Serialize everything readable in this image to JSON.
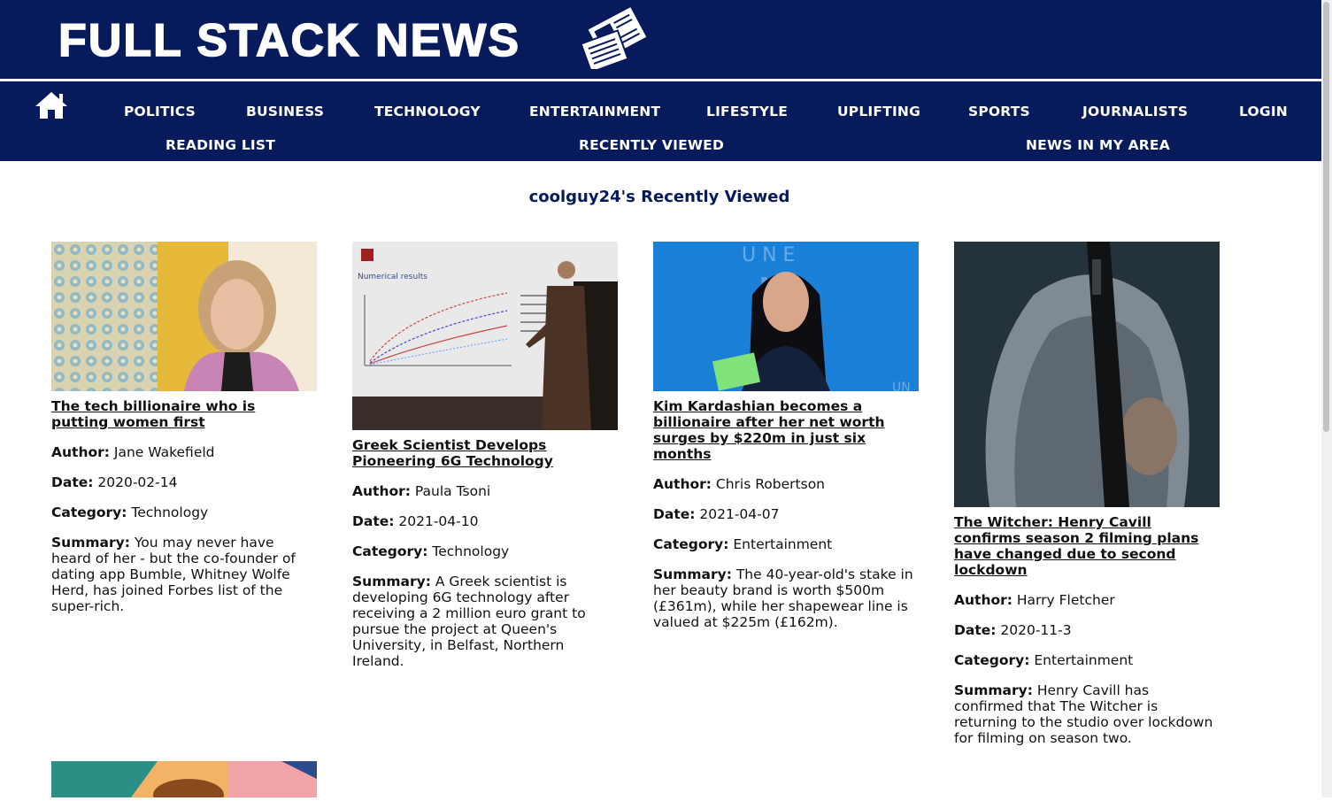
{
  "site": {
    "logo_text": "FULL STACK NEWS"
  },
  "nav": {
    "row1": [
      "POLITICS",
      "BUSINESS",
      "TECHNOLOGY",
      "ENTERTAINMENT",
      "LIFESTYLE",
      "UPLIFTING",
      "SPORTS",
      "JOURNALISTS",
      "LOGIN"
    ],
    "row2": [
      "READING LIST",
      "RECENTLY VIEWED",
      "NEWS IN MY AREA"
    ]
  },
  "page": {
    "heading": "coolguy24's Recently Viewed"
  },
  "labels": {
    "author": "Author:",
    "date": "Date:",
    "category": "Category:",
    "summary": "Summary:"
  },
  "articles": [
    {
      "title": "The tech billionaire who is putting women first",
      "author": "Jane Wakefield",
      "date": "2020-02-14",
      "category": "Technology",
      "summary": "You may never have heard of her - but the co-founder of dating app Bumble, Whitney Wolfe Herd, has joined Forbes list of the super-rich."
    },
    {
      "title": "Greek Scientist Develops Pioneering 6G Technology",
      "author": "Paula Tsoni",
      "date": "2021-04-10",
      "category": "Technology",
      "summary": "A Greek scientist is developing 6G technology after receiving a 2 million euro grant to pursue the project at Queen's University, in Belfast, Northern Ireland."
    },
    {
      "title": "Kim Kardashian becomes a billionaire after her net worth surges by $220m in just six months",
      "author": "Chris Robertson",
      "date": "2021-04-07",
      "category": "Entertainment",
      "summary": "The 40-year-old's stake in her beauty brand is worth $500m (£361m), while her shapewear line is valued at $225m (£162m)."
    },
    {
      "title": "The Witcher: Henry Cavill confirms season 2 filming plans have changed due to second lockdown",
      "author": "Harry Fletcher",
      "date": "2020-11-3",
      "category": "Entertainment",
      "summary": "Henry Cavill has confirmed that The Witcher is returning to the studio over lockdown for filming on season two."
    }
  ],
  "slide": {
    "heading": "Numerical results"
  },
  "colors": {
    "navy": "#061a5c",
    "white": "#ffffff"
  }
}
